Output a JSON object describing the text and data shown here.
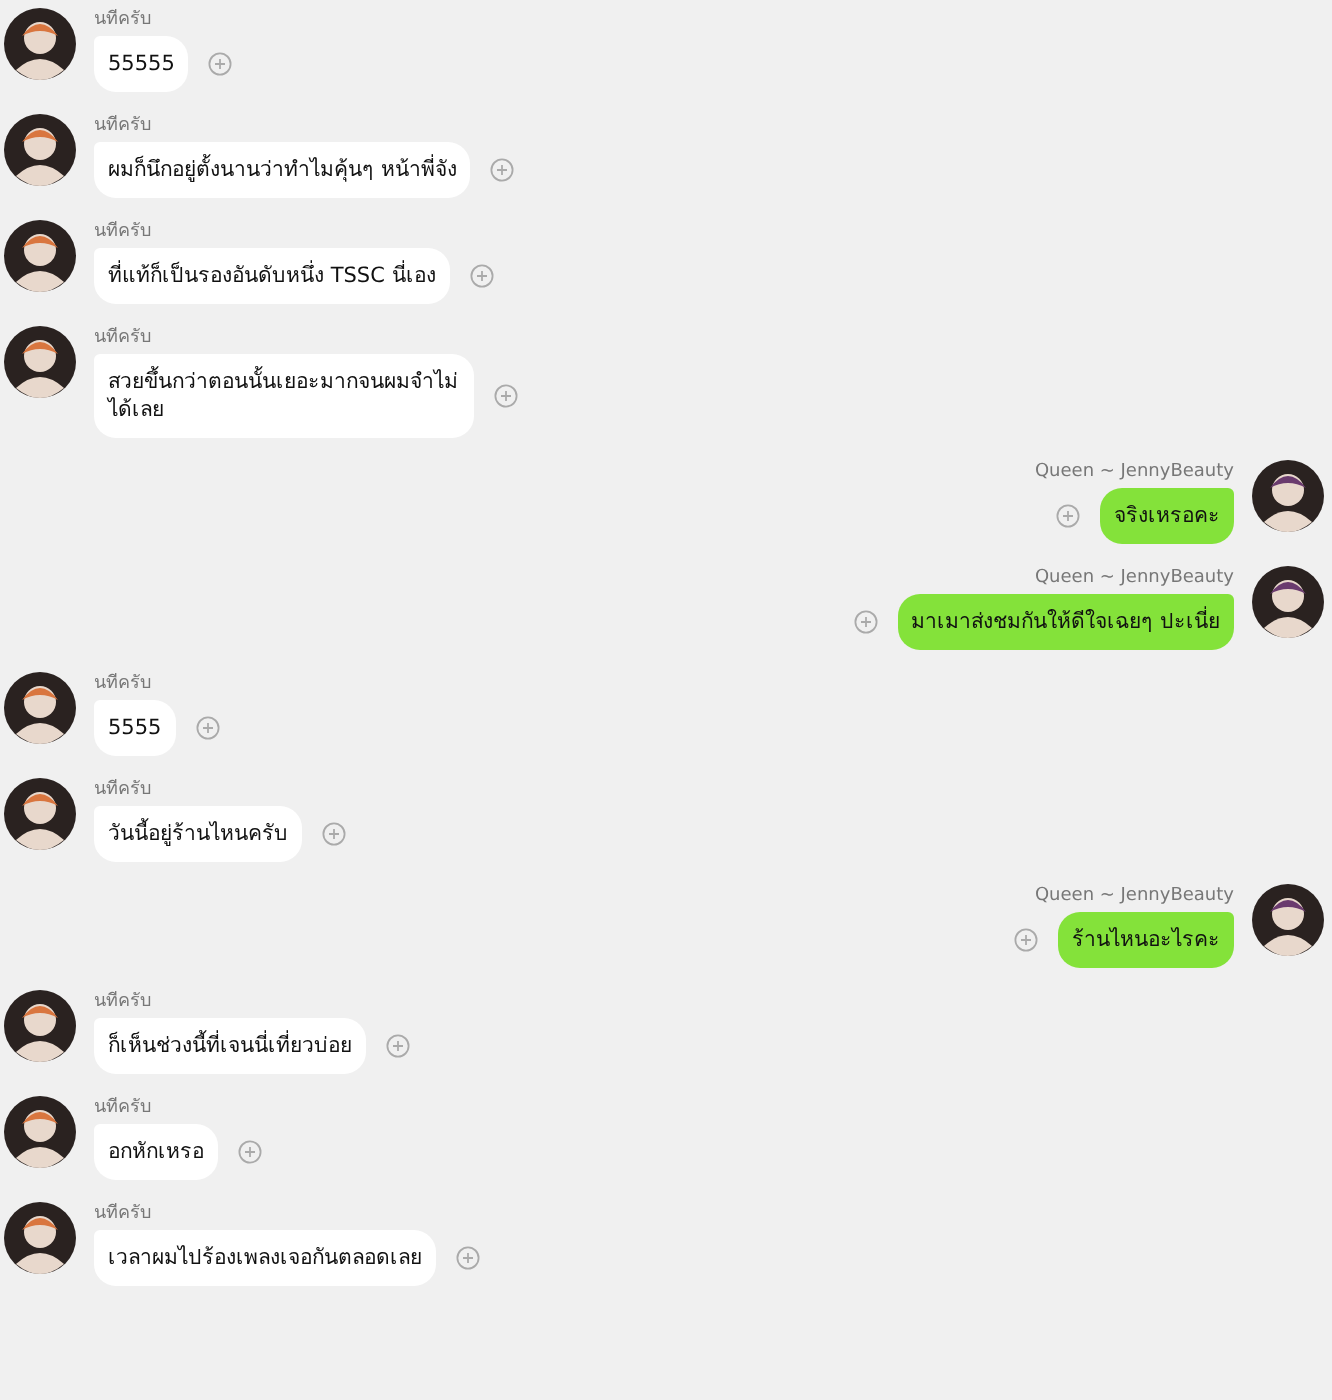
{
  "messages": [
    {
      "kind": "incoming",
      "sender": "นทีครับ",
      "text": "55555"
    },
    {
      "kind": "incoming",
      "sender": "นทีครับ",
      "text": "ผมก็นึกอยู่ตั้งนานว่าทำไมคุ้นๆ หน้าพี่จัง"
    },
    {
      "kind": "incoming",
      "sender": "นทีครับ",
      "text": "ที่แท้ก็เป็นรองอันดับหนึ่ง TSSC นี่เอง"
    },
    {
      "kind": "incoming",
      "sender": "นทีครับ",
      "text": "สวยขึ้นกว่าตอนนั้นเยอะมากจนผมจำไม่ได้เลย"
    },
    {
      "kind": "outgoing",
      "sender": "Queen ~ JennyBeauty",
      "text": "จริงเหรอคะ"
    },
    {
      "kind": "outgoing",
      "sender": "Queen ~ JennyBeauty",
      "text": "มาเมาส่งชมกันให้ดีใจเฉยๆ ปะเนี่ย"
    },
    {
      "kind": "incoming",
      "sender": "นทีครับ",
      "text": "5555"
    },
    {
      "kind": "incoming",
      "sender": "นทีครับ",
      "text": "วันนี้อยู่ร้านไหนครับ"
    },
    {
      "kind": "outgoing",
      "sender": "Queen ~ JennyBeauty",
      "text": "ร้านไหนอะไรคะ"
    },
    {
      "kind": "incoming",
      "sender": "นทีครับ",
      "text": "ก็เห็นช่วงนี้ที่เจนนี่เที่ยวบ่อย"
    },
    {
      "kind": "incoming",
      "sender": "นทีครับ",
      "text": "อกหักเหรอ"
    },
    {
      "kind": "incoming",
      "sender": "นทีครับ",
      "text": "เวลาผมไปร้องเพลงเจอกันตลอดเลย"
    }
  ]
}
